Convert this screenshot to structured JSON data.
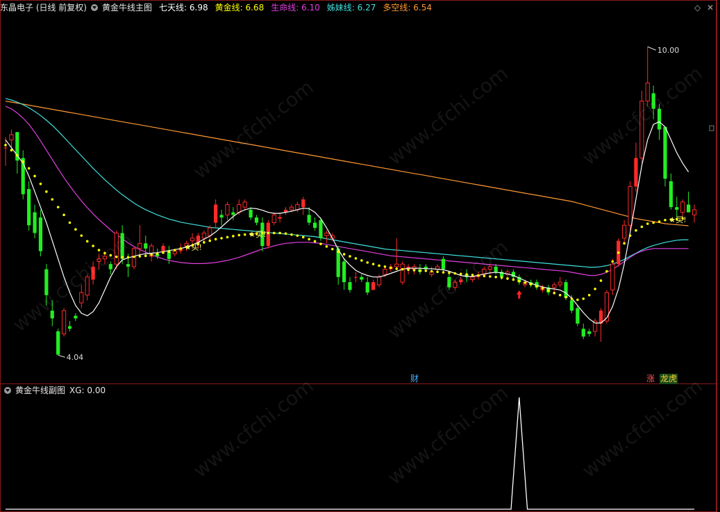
{
  "header": {
    "stock": "东晶电子 (日线 前复权)",
    "indicator": "黄金牛线主图",
    "lines": [
      {
        "label": "七天线:",
        "value": "6.98",
        "color": "#ffffff"
      },
      {
        "label": "黄金线:",
        "value": "6.68",
        "color": "#ffff00"
      },
      {
        "label": "生命线:",
        "value": "6.10",
        "color": "#e040e0"
      },
      {
        "label": "姊妹线:",
        "value": "6.27",
        "color": "#40e0e0"
      },
      {
        "label": "多空线:",
        "value": "6.54",
        "color": "#ff9933"
      }
    ],
    "controls": {
      "diamond": "◇",
      "close": "✕",
      "collapse": "▫"
    }
  },
  "sub_header": {
    "indicator": "黄金牛线副图",
    "xg_label": "XG:",
    "xg_value": "0.00"
  },
  "tags": {
    "cai": "财",
    "zhang": "涨",
    "longhu": "龙虎",
    "buy": "★买!"
  },
  "watermark": "www.cfchi.com",
  "chart_data": {
    "type": "candlestick",
    "title": "东晶电子 (日线 前复权)",
    "ylim": [
      3.6,
      10.5
    ],
    "price_high_label": "10.00",
    "price_low_label": "4.04",
    "colors": {
      "up": "#ff2a2a",
      "down": "#22ee22",
      "ma7": "#ffffff",
      "gold": "#ffff00",
      "life": "#e040e0",
      "sister": "#40e0e0",
      "longshort": "#ff9933"
    },
    "candles": [
      [
        8.05,
        8.25,
        7.7,
        8.05
      ],
      [
        8.2,
        8.4,
        8.0,
        8.3
      ],
      [
        8.35,
        8.35,
        7.55,
        7.8
      ],
      [
        7.85,
        8.0,
        7.05,
        7.15
      ],
      [
        7.25,
        7.4,
        6.45,
        6.55
      ],
      [
        6.8,
        6.95,
        6.3,
        6.4
      ],
      [
        6.7,
        6.85,
        5.95,
        6.05
      ],
      [
        5.7,
        5.8,
        5.0,
        5.2
      ],
      [
        4.9,
        5.1,
        4.6,
        4.75
      ],
      [
        4.5,
        4.55,
        4.04,
        4.05
      ],
      [
        4.45,
        4.95,
        4.4,
        4.9
      ],
      [
        4.6,
        4.7,
        4.5,
        4.55
      ],
      [
        4.8,
        4.85,
        4.7,
        4.75
      ],
      [
        5.05,
        5.4,
        4.95,
        5.25
      ],
      [
        5.2,
        5.6,
        5.1,
        5.55
      ],
      [
        5.5,
        5.85,
        5.4,
        5.75
      ],
      [
        5.85,
        6.0,
        5.7,
        5.9
      ],
      [
        5.9,
        6.05,
        5.8,
        5.95
      ],
      [
        5.8,
        5.85,
        5.6,
        5.7
      ],
      [
        5.8,
        6.45,
        5.7,
        6.4
      ],
      [
        6.4,
        6.55,
        5.8,
        5.9
      ],
      [
        5.8,
        6.0,
        5.55,
        5.75
      ],
      [
        5.75,
        6.15,
        5.7,
        6.1
      ],
      [
        6.1,
        6.55,
        5.95,
        6.2
      ],
      [
        6.2,
        6.35,
        6.0,
        6.1
      ],
      [
        5.95,
        6.2,
        5.85,
        6.15
      ],
      [
        6.0,
        6.1,
        5.9,
        5.95
      ],
      [
        6.05,
        6.2,
        6.0,
        6.15
      ],
      [
        6.05,
        6.15,
        5.8,
        5.9
      ],
      [
        6.0,
        6.1,
        5.95,
        6.05
      ],
      [
        6.05,
        6.2,
        6.0,
        6.1
      ],
      [
        6.15,
        6.25,
        6.05,
        6.2
      ],
      [
        6.25,
        6.4,
        6.15,
        6.3
      ],
      [
        6.2,
        6.4,
        6.1,
        6.35
      ],
      [
        6.3,
        6.45,
        6.2,
        6.4
      ],
      [
        6.35,
        6.55,
        6.25,
        6.5
      ],
      [
        6.6,
        7.05,
        6.5,
        6.95
      ],
      [
        6.75,
        6.85,
        6.55,
        6.7
      ],
      [
        6.75,
        7.0,
        6.65,
        6.95
      ],
      [
        6.8,
        6.9,
        6.65,
        6.75
      ],
      [
        6.8,
        7.05,
        6.75,
        6.95
      ],
      [
        6.9,
        7.05,
        6.85,
        7.0
      ],
      [
        6.85,
        6.9,
        6.65,
        6.7
      ],
      [
        6.7,
        6.75,
        6.55,
        6.6
      ],
      [
        6.6,
        6.7,
        6.05,
        6.15
      ],
      [
        6.15,
        6.65,
        6.1,
        6.6
      ],
      [
        6.6,
        6.8,
        6.55,
        6.75
      ],
      [
        6.7,
        6.8,
        6.6,
        6.7
      ],
      [
        6.8,
        6.9,
        6.75,
        6.85
      ],
      [
        6.85,
        6.95,
        6.8,
        6.9
      ],
      [
        6.85,
        7.0,
        6.8,
        6.95
      ],
      [
        6.9,
        7.1,
        6.75,
        7.05
      ],
      [
        6.75,
        6.9,
        6.55,
        6.6
      ],
      [
        6.6,
        6.7,
        6.45,
        6.5
      ],
      [
        6.65,
        6.7,
        6.25,
        6.3
      ],
      [
        6.35,
        6.45,
        6.2,
        6.4
      ],
      [
        6.3,
        6.4,
        6.25,
        6.35
      ],
      [
        6.1,
        6.15,
        5.4,
        5.55
      ],
      [
        5.85,
        5.9,
        5.3,
        5.45
      ],
      [
        5.45,
        5.55,
        5.25,
        5.3
      ],
      [
        5.55,
        5.65,
        5.45,
        5.55
      ],
      [
        5.55,
        5.6,
        5.45,
        5.5
      ],
      [
        5.45,
        5.55,
        5.2,
        5.25
      ],
      [
        5.3,
        5.5,
        5.3,
        5.45
      ],
      [
        5.4,
        5.6,
        5.35,
        5.55
      ],
      [
        5.6,
        5.75,
        5.55,
        5.7
      ],
      [
        5.7,
        5.8,
        5.65,
        5.75
      ],
      [
        5.75,
        6.3,
        5.7,
        5.8
      ],
      [
        5.45,
        5.85,
        5.4,
        5.8
      ],
      [
        5.7,
        5.8,
        5.6,
        5.75
      ],
      [
        5.7,
        5.8,
        5.6,
        5.75
      ],
      [
        5.7,
        5.8,
        5.6,
        5.65
      ],
      [
        5.75,
        5.8,
        5.65,
        5.7
      ],
      [
        5.6,
        5.75,
        5.55,
        5.65
      ],
      [
        5.7,
        5.8,
        5.65,
        5.75
      ],
      [
        5.9,
        5.95,
        5.65,
        5.7
      ],
      [
        5.55,
        5.65,
        5.3,
        5.35
      ],
      [
        5.35,
        5.5,
        5.3,
        5.45
      ],
      [
        5.45,
        5.55,
        5.4,
        5.5
      ],
      [
        5.6,
        5.7,
        5.45,
        5.55
      ],
      [
        5.5,
        5.6,
        5.45,
        5.55
      ],
      [
        5.55,
        5.65,
        5.5,
        5.6
      ],
      [
        5.6,
        5.75,
        5.55,
        5.7
      ],
      [
        5.7,
        5.8,
        5.6,
        5.75
      ],
      [
        5.75,
        5.8,
        5.6,
        5.65
      ],
      [
        5.65,
        5.7,
        5.5,
        5.55
      ],
      [
        5.6,
        5.7,
        5.55,
        5.65
      ],
      [
        5.65,
        5.7,
        5.5,
        5.55
      ],
      [
        5.55,
        5.6,
        5.4,
        5.45
      ],
      [
        5.4,
        5.5,
        5.35,
        5.45
      ],
      [
        5.45,
        5.5,
        5.35,
        5.4
      ],
      [
        5.45,
        5.5,
        5.3,
        5.35
      ],
      [
        5.3,
        5.4,
        5.25,
        5.35
      ],
      [
        5.35,
        5.4,
        5.2,
        5.25
      ],
      [
        5.35,
        5.45,
        5.25,
        5.4
      ],
      [
        5.4,
        5.55,
        5.35,
        5.45
      ],
      [
        5.45,
        5.5,
        5.1,
        5.15
      ],
      [
        5.1,
        5.2,
        4.85,
        4.9
      ],
      [
        4.95,
        5.0,
        4.6,
        4.65
      ],
      [
        4.55,
        4.65,
        4.35,
        4.4
      ],
      [
        4.5,
        4.55,
        4.4,
        4.45
      ],
      [
        4.5,
        4.75,
        4.4,
        4.7
      ],
      [
        4.65,
        4.95,
        4.3,
        4.9
      ],
      [
        4.7,
        5.3,
        4.65,
        5.25
      ],
      [
        5.3,
        5.9,
        5.2,
        5.8
      ],
      [
        5.8,
        6.3,
        5.75,
        6.25
      ],
      [
        6.3,
        6.65,
        6.2,
        6.55
      ],
      [
        6.55,
        7.4,
        6.45,
        7.3
      ],
      [
        7.3,
        8.15,
        7.2,
        7.85
      ],
      [
        7.85,
        9.15,
        7.75,
        8.95
      ],
      [
        8.95,
        10.0,
        8.85,
        9.3
      ],
      [
        9.1,
        9.25,
        8.6,
        8.8
      ],
      [
        8.8,
        8.9,
        8.2,
        8.4
      ],
      [
        8.45,
        8.45,
        7.3,
        7.45
      ],
      [
        7.4,
        7.55,
        6.85,
        6.9
      ],
      [
        6.9,
        7.1,
        6.7,
        6.85
      ],
      [
        6.8,
        7.05,
        6.65,
        7.0
      ],
      [
        6.95,
        7.2,
        6.8,
        6.8
      ],
      [
        6.75,
        6.95,
        6.6,
        6.85
      ]
    ],
    "ma7": [
      8.2,
      8.05,
      7.9,
      7.75,
      7.5,
      7.2,
      6.9,
      6.6,
      6.25,
      5.9,
      5.55,
      5.25,
      5.0,
      4.85,
      4.8,
      4.88,
      5.05,
      5.3,
      5.55,
      5.75,
      5.88,
      5.92,
      5.95,
      5.98,
      6.0,
      6.01,
      6.02,
      6.04,
      6.06,
      6.08,
      6.1,
      6.13,
      6.17,
      6.22,
      6.28,
      6.34,
      6.42,
      6.52,
      6.62,
      6.72,
      6.8,
      6.85,
      6.88,
      6.87,
      6.84,
      6.8,
      6.78,
      6.78,
      6.8,
      6.82,
      6.85,
      6.88,
      6.87,
      6.8,
      6.68,
      6.5,
      6.3,
      6.08,
      5.9,
      5.78,
      5.68,
      5.62,
      5.58,
      5.55,
      5.55,
      5.58,
      5.62,
      5.66,
      5.7,
      5.72,
      5.72,
      5.72,
      5.71,
      5.71,
      5.7,
      5.69,
      5.66,
      5.62,
      5.58,
      5.56,
      5.56,
      5.58,
      5.61,
      5.63,
      5.64,
      5.63,
      5.61,
      5.58,
      5.53,
      5.48,
      5.43,
      5.39,
      5.36,
      5.33,
      5.32,
      5.3,
      5.24,
      5.14,
      5.0,
      4.86,
      4.74,
      4.66,
      4.66,
      4.76,
      4.98,
      5.32,
      5.8,
      6.4,
      7.05,
      7.7,
      8.2,
      8.5,
      8.55,
      8.45,
      8.2,
      7.95,
      7.75,
      7.58
    ],
    "gold": [
      8.1,
      8.0,
      7.9,
      7.78,
      7.65,
      7.5,
      7.35,
      7.2,
      7.05,
      6.9,
      6.75,
      6.6,
      6.47,
      6.35,
      6.24,
      6.15,
      6.07,
      6.01,
      5.97,
      5.94,
      5.93,
      5.93,
      5.94,
      5.95,
      5.96,
      5.98,
      6.0,
      6.02,
      6.04,
      6.07,
      6.1,
      6.13,
      6.16,
      6.19,
      6.22,
      6.25,
      6.28,
      6.3,
      6.32,
      6.34,
      6.36,
      6.37,
      6.38,
      6.39,
      6.4,
      6.4,
      6.4,
      6.4,
      6.39,
      6.37,
      6.35,
      6.32,
      6.28,
      6.24,
      6.19,
      6.14,
      6.09,
      6.04,
      5.99,
      5.95,
      5.91,
      5.87,
      5.83,
      5.8,
      5.77,
      5.75,
      5.73,
      5.71,
      5.7,
      5.69,
      5.68,
      5.67,
      5.67,
      5.66,
      5.65,
      5.64,
      5.63,
      5.62,
      5.61,
      5.6,
      5.59,
      5.58,
      5.57,
      5.56,
      5.55,
      5.54,
      5.52,
      5.5,
      5.47,
      5.44,
      5.41,
      5.37,
      5.33,
      5.29,
      5.24,
      5.2,
      5.16,
      5.13,
      5.11,
      5.13,
      5.2,
      5.32,
      5.48,
      5.66,
      5.85,
      6.02,
      6.2,
      6.35,
      6.45,
      6.52,
      6.58,
      6.6,
      6.62,
      6.65,
      6.66,
      6.67,
      6.68
    ],
    "life": [
      8.85,
      8.8,
      8.72,
      8.62,
      8.5,
      8.35,
      8.18,
      8.0,
      7.82,
      7.64,
      7.47,
      7.31,
      7.16,
      7.02,
      6.89,
      6.77,
      6.66,
      6.56,
      6.46,
      6.37,
      6.29,
      6.21,
      6.14,
      6.08,
      6.03,
      5.98,
      5.94,
      5.9,
      5.87,
      5.85,
      5.83,
      5.82,
      5.81,
      5.81,
      5.81,
      5.82,
      5.83,
      5.85,
      5.87,
      5.9,
      5.93,
      5.97,
      6.01,
      6.05,
      6.09,
      6.12,
      6.15,
      6.18,
      6.2,
      6.21,
      6.22,
      6.22,
      6.22,
      6.21,
      6.2,
      6.18,
      6.16,
      6.14,
      6.12,
      6.1,
      6.08,
      6.06,
      6.04,
      6.02,
      6.0,
      5.98,
      5.96,
      5.95,
      5.94,
      5.93,
      5.92,
      5.91,
      5.9,
      5.89,
      5.88,
      5.87,
      5.86,
      5.85,
      5.84,
      5.83,
      5.82,
      5.81,
      5.8,
      5.79,
      5.78,
      5.77,
      5.76,
      5.75,
      5.74,
      5.73,
      5.72,
      5.71,
      5.7,
      5.69,
      5.68,
      5.67,
      5.66,
      5.64,
      5.62,
      5.6,
      5.58,
      5.58,
      5.6,
      5.64,
      5.7,
      5.77,
      5.85,
      5.93,
      6.0,
      6.05,
      6.08,
      6.1,
      6.1,
      6.1,
      6.1,
      6.1,
      6.1,
      6.1
    ],
    "sister": [
      9.0,
      8.97,
      8.93,
      8.88,
      8.82,
      8.75,
      8.67,
      8.58,
      8.48,
      8.37,
      8.25,
      8.13,
      8.01,
      7.89,
      7.77,
      7.65,
      7.54,
      7.43,
      7.33,
      7.23,
      7.14,
      7.06,
      6.98,
      6.91,
      6.85,
      6.8,
      6.75,
      6.71,
      6.67,
      6.64,
      6.61,
      6.59,
      6.57,
      6.55,
      6.53,
      6.51,
      6.5,
      6.49,
      6.48,
      6.47,
      6.46,
      6.45,
      6.44,
      6.43,
      6.42,
      6.41,
      6.4,
      6.39,
      6.38,
      6.37,
      6.36,
      6.35,
      6.34,
      6.33,
      6.31,
      6.29,
      6.27,
      6.25,
      6.23,
      6.21,
      6.19,
      6.17,
      6.15,
      6.13,
      6.11,
      6.09,
      6.08,
      6.07,
      6.06,
      6.05,
      6.04,
      6.03,
      6.02,
      6.01,
      6.0,
      5.99,
      5.98,
      5.97,
      5.96,
      5.95,
      5.94,
      5.93,
      5.92,
      5.91,
      5.9,
      5.89,
      5.88,
      5.87,
      5.86,
      5.85,
      5.84,
      5.83,
      5.82,
      5.81,
      5.8,
      5.79,
      5.78,
      5.77,
      5.76,
      5.75,
      5.74,
      5.74,
      5.75,
      5.77,
      5.8,
      5.84,
      5.89,
      5.95,
      6.01,
      6.07,
      6.12,
      6.16,
      6.19,
      6.22,
      6.24,
      6.26,
      6.27,
      6.27
    ],
    "longshort": [
      8.95,
      8.93,
      8.91,
      8.89,
      8.87,
      8.85,
      8.83,
      8.81,
      8.79,
      8.77,
      8.75,
      8.73,
      8.71,
      8.69,
      8.67,
      8.65,
      8.63,
      8.61,
      8.59,
      8.57,
      8.55,
      8.53,
      8.51,
      8.49,
      8.47,
      8.45,
      8.43,
      8.41,
      8.39,
      8.37,
      8.35,
      8.33,
      8.31,
      8.29,
      8.27,
      8.25,
      8.23,
      8.21,
      8.19,
      8.17,
      8.15,
      8.13,
      8.11,
      8.09,
      8.07,
      8.05,
      8.03,
      8.01,
      7.99,
      7.97,
      7.95,
      7.93,
      7.91,
      7.89,
      7.87,
      7.85,
      7.83,
      7.81,
      7.79,
      7.77,
      7.75,
      7.73,
      7.71,
      7.69,
      7.67,
      7.65,
      7.63,
      7.61,
      7.59,
      7.57,
      7.55,
      7.53,
      7.51,
      7.49,
      7.47,
      7.45,
      7.43,
      7.41,
      7.39,
      7.37,
      7.35,
      7.33,
      7.31,
      7.29,
      7.27,
      7.25,
      7.23,
      7.21,
      7.19,
      7.17,
      7.15,
      7.13,
      7.11,
      7.09,
      7.07,
      7.05,
      7.03,
      7.01,
      6.98,
      6.95,
      6.92,
      6.89,
      6.86,
      6.83,
      6.8,
      6.77,
      6.74,
      6.71,
      6.68,
      6.66,
      6.64,
      6.62,
      6.6,
      6.58,
      6.57,
      6.56,
      6.55,
      6.54
    ],
    "buy_signals": [
      31,
      42,
      114
    ],
    "arrow_signal": 88,
    "xg": {
      "values": [
        0,
        0,
        1,
        0,
        0
      ],
      "spike_index": 88,
      "ylim": [
        0,
        1
      ]
    }
  }
}
